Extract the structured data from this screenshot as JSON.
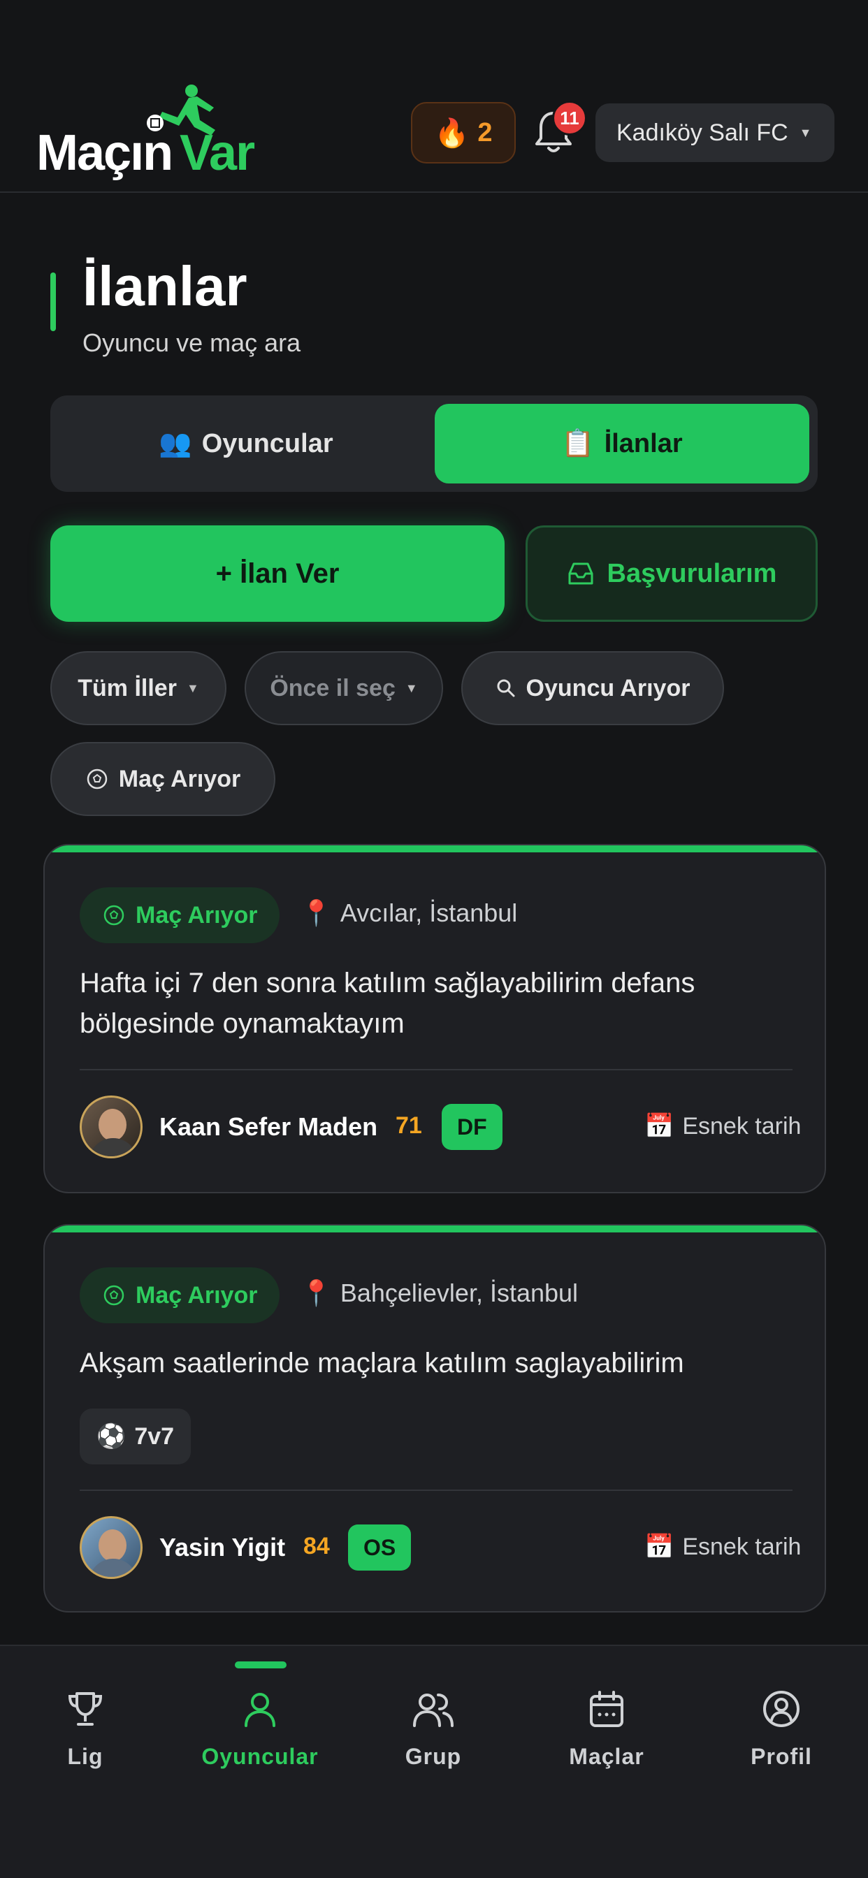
{
  "app": {
    "logo_primary": "Maçın",
    "logo_secondary": "Var",
    "streak_count": "2",
    "notification_count": "11",
    "team_name": "Kadıköy Salı FC"
  },
  "page": {
    "title": "İlanlar",
    "subtitle": "Oyuncu ve maç ara"
  },
  "tabs": [
    {
      "label": "Oyuncular",
      "icon": "people-icon",
      "active": false
    },
    {
      "label": "İlanlar",
      "icon": "clipboard-icon",
      "active": true
    }
  ],
  "actions": {
    "create_label": "+ İlan Ver",
    "applications_label": "Başvurularım"
  },
  "filters": {
    "city": "Tüm İller",
    "district": "Önce il seç",
    "player_search": "Oyuncu Arıyor",
    "match_search": "Maç Arıyor"
  },
  "listings": [
    {
      "tag": "Maç Arıyor",
      "location": "Avcılar, İstanbul",
      "description_line1": "Hafta içi 7 den sonra katılım sağlayabilirim defans",
      "description_line2": "bölgesinde oynamaktayım",
      "user": "Kaan Sefer Maden",
      "rating": "71",
      "position": "DF",
      "date": "Esnek tarih"
    },
    {
      "tag": "Maç Arıyor",
      "location": "Bahçelievler, İstanbul",
      "description_line1": "Akşam saatlerinde maçlara katılım saglayabilirim",
      "format": "7v7",
      "user": "Yasin Yigit",
      "rating": "84",
      "position": "OS",
      "date": "Esnek tarih"
    }
  ],
  "nav": [
    {
      "label": "Lig",
      "icon": "trophy-icon"
    },
    {
      "label": "Oyuncular",
      "icon": "user-icon",
      "active": true
    },
    {
      "label": "Grup",
      "icon": "group-icon"
    },
    {
      "label": "Maçlar",
      "icon": "calendar-icon"
    },
    {
      "label": "Profil",
      "icon": "profile-icon"
    }
  ],
  "colors": {
    "accent": "#22c55e",
    "background": "#141517",
    "card": "#1e1f23",
    "rating": "#f5a623",
    "badge": "#e63b3b"
  }
}
